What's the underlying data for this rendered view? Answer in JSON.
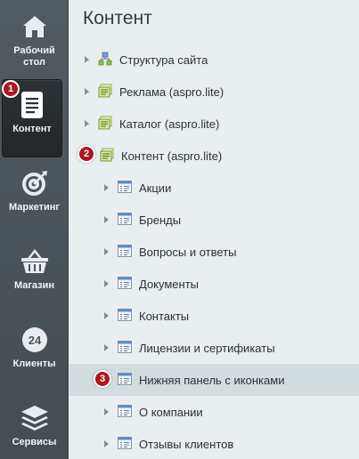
{
  "sidebar": {
    "items": [
      {
        "label": "Рабочий стол",
        "icon": "home-icon"
      },
      {
        "label": "Контент",
        "icon": "document-icon",
        "active": true
      },
      {
        "label": "Маркетинг",
        "icon": "target-icon"
      },
      {
        "label": "Магазин",
        "icon": "basket-icon"
      },
      {
        "label": "Клиенты",
        "icon": "clients-24-icon",
        "icon_text": "24"
      },
      {
        "label": "Сервисы",
        "icon": "layers-icon"
      }
    ]
  },
  "panel": {
    "title": "Контент",
    "tree": [
      {
        "label": "Структура сайта",
        "icon": "site-structure-icon",
        "level": 0
      },
      {
        "label": "Реклама (aspro.lite)",
        "icon": "iblock-type-icon",
        "level": 0
      },
      {
        "label": "Каталог (aspro.lite)",
        "icon": "iblock-type-icon",
        "level": 0
      },
      {
        "label": "Контент (aspro.lite)",
        "icon": "iblock-type-icon",
        "level": 0
      },
      {
        "label": "Акции",
        "icon": "iblock-icon",
        "level": 1
      },
      {
        "label": "Бренды",
        "icon": "iblock-icon",
        "level": 1
      },
      {
        "label": "Вопросы и ответы",
        "icon": "iblock-icon",
        "level": 1
      },
      {
        "label": "Документы",
        "icon": "iblock-icon",
        "level": 1
      },
      {
        "label": "Контакты",
        "icon": "iblock-icon",
        "level": 1
      },
      {
        "label": "Лицензии и сертификаты",
        "icon": "iblock-icon",
        "level": 1
      },
      {
        "label": "Нижняя панель с иконками",
        "icon": "iblock-icon",
        "level": 1,
        "highlighted": true
      },
      {
        "label": "О компании",
        "icon": "iblock-icon",
        "level": 1
      },
      {
        "label": "Отзывы клиентов",
        "icon": "iblock-icon",
        "level": 1
      }
    ]
  },
  "badges": [
    "1",
    "2",
    "3"
  ],
  "colors": {
    "sidebar_bg": "#4d555b",
    "panel_bg": "#e9eef0",
    "badge": "#b0151f",
    "highlight_row": "#d3dcdf"
  }
}
